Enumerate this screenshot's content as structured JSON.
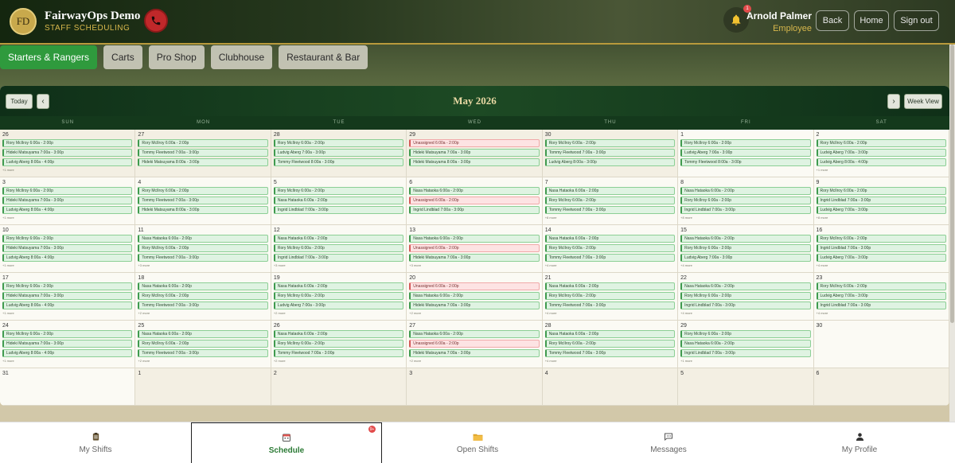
{
  "header": {
    "logo_text": "FD",
    "brand_title": "FairwayOps Demo",
    "brand_subtitle": "STAFF SCHEDULING",
    "notification_count": "1",
    "user_name": "Arnold Palmer",
    "user_role": "Employee",
    "back_label": "Back",
    "home_label": "Home",
    "signout_label": "Sign out"
  },
  "tabs": [
    {
      "label": "Starters & Rangers",
      "active": true
    },
    {
      "label": "Carts",
      "active": false
    },
    {
      "label": "Pro Shop",
      "active": false
    },
    {
      "label": "Clubhouse",
      "active": false
    },
    {
      "label": "Restaurant & Bar",
      "active": false
    }
  ],
  "calendar": {
    "title": "May 2026",
    "today_label": "Today",
    "prev_label": "‹",
    "next_label": "›",
    "view_label": "Week View",
    "weekdays": [
      "SUN",
      "MON",
      "TUE",
      "WED",
      "THU",
      "FRI",
      "SAT"
    ],
    "weeks": [
      [
        {
          "day": "26",
          "out": true,
          "shifts": [
            [
              "Rory McIlroy 6:00a - 2:00p",
              false
            ],
            [
              "Hideki Matsuyama 7:00a - 3:00p",
              false
            ],
            [
              "Ludvig Aberg 8:00a - 4:00p",
              false
            ]
          ],
          "more": "+1 more"
        },
        {
          "day": "27",
          "out": true,
          "shifts": [
            [
              "Rory McIlroy 6:00a - 2:00p",
              false
            ],
            [
              "Tommy Fleetwood 7:00a - 3:00p",
              false
            ],
            [
              "Hideki Matsuyama 8:00a - 3:00p",
              false
            ]
          ],
          "more": ""
        },
        {
          "day": "28",
          "out": true,
          "shifts": [
            [
              "Rory McIlroy 6:00a - 2:00p",
              false
            ],
            [
              "Ludvig Aberg 7:00a - 3:00p",
              false
            ],
            [
              "Tommy Fleetwood 8:00a - 3:00p",
              false
            ]
          ],
          "more": ""
        },
        {
          "day": "29",
          "out": true,
          "shifts": [
            [
              "Unassigned 6:00a - 2:00p",
              true
            ],
            [
              "Hideki Matsuyama 7:00a - 3:00p",
              false
            ],
            [
              "Hideki Matsuyama 8:00a - 3:00p",
              false
            ]
          ],
          "more": ""
        },
        {
          "day": "30",
          "out": true,
          "shifts": [
            [
              "Rory McIlroy 6:00a - 2:00p",
              false
            ],
            [
              "Tommy Fleetwood 7:00a - 3:00p",
              false
            ],
            [
              "Ludvig Aberg 8:00a - 3:00p",
              false
            ]
          ],
          "more": ""
        },
        {
          "day": "1",
          "out": false,
          "shifts": [
            [
              "Rory McIlroy 6:00a - 2:00p",
              false
            ],
            [
              "Ludvig Aberg 7:00a - 3:00p",
              false
            ],
            [
              "Tommy Fleetwood 8:00a - 3:00p",
              false
            ]
          ],
          "more": ""
        },
        {
          "day": "2",
          "out": false,
          "shifts": [
            [
              "Rory McIlroy 6:00a - 2:00p",
              false
            ],
            [
              "Ludvig Aberg 7:00a - 3:00p",
              false
            ],
            [
              "Ludvig Aberg 8:00a - 4:00p",
              false
            ]
          ],
          "more": "+1 more"
        }
      ],
      [
        {
          "day": "3",
          "out": false,
          "shifts": [
            [
              "Rory McIlroy 6:00a - 2:00p",
              false
            ],
            [
              "Hideki Matsuyama 7:00a - 3:00p",
              false
            ],
            [
              "Ludvig Aberg 8:00a - 4:00p",
              false
            ]
          ],
          "more": "+1 more"
        },
        {
          "day": "4",
          "out": false,
          "shifts": [
            [
              "Rory McIlroy 6:00a - 2:00p",
              false
            ],
            [
              "Tommy Fleetwood 7:00a - 3:00p",
              false
            ],
            [
              "Hideki Matsuyama 8:00a - 3:00p",
              false
            ]
          ],
          "more": ""
        },
        {
          "day": "5",
          "out": false,
          "shifts": [
            [
              "Rory McIlroy 6:00a - 2:00p",
              false
            ],
            [
              "Nasa Hataoka 6:00a - 2:00p",
              false
            ],
            [
              "Ingrid Lindblad 7:00a - 3:00p",
              false
            ]
          ],
          "more": ""
        },
        {
          "day": "6",
          "out": false,
          "shifts": [
            [
              "Nasa Hataoka 6:00a - 2:00p",
              false
            ],
            [
              "Unassigned 6:00a - 2:00p",
              true
            ],
            [
              "Ingrid Lindblad 7:00a - 3:00p",
              false
            ]
          ],
          "more": ""
        },
        {
          "day": "7",
          "out": false,
          "shifts": [
            [
              "Nasa Hataoka 6:00a - 2:00p",
              false
            ],
            [
              "Rory McIlroy 6:00a - 2:00p",
              false
            ],
            [
              "Tommy Fleetwood 7:00a - 3:00p",
              false
            ]
          ],
          "more": "+8 more"
        },
        {
          "day": "8",
          "out": false,
          "shifts": [
            [
              "Nasa Hataoka 6:00a - 2:00p",
              false
            ],
            [
              "Rory McIlroy 6:00a - 2:00p",
              false
            ],
            [
              "Ingrid Lindblad 7:00a - 3:00p",
              false
            ]
          ],
          "more": "+8 more"
        },
        {
          "day": "9",
          "out": false,
          "shifts": [
            [
              "Rory McIlroy 6:00a - 2:00p",
              false
            ],
            [
              "Ingrid Lindblad 7:00a - 3:00p",
              false
            ],
            [
              "Ludvig Aberg 7:00a - 3:00p",
              false
            ]
          ],
          "more": "+8 more"
        }
      ],
      [
        {
          "day": "10",
          "out": false,
          "shifts": [
            [
              "Rory McIlroy 6:00a - 2:00p",
              false
            ],
            [
              "Hideki Matsuyama 7:00a - 3:00p",
              false
            ],
            [
              "Ludvig Aberg 8:00a - 4:00p",
              false
            ]
          ],
          "more": "+1 more"
        },
        {
          "day": "11",
          "out": false,
          "shifts": [
            [
              "Nasa Hataoka 6:00a - 2:00p",
              false
            ],
            [
              "Rory McIlroy 6:00a - 2:00p",
              false
            ],
            [
              "Tommy Fleetwood 7:00a - 3:00p",
              false
            ]
          ],
          "more": "+3 more"
        },
        {
          "day": "12",
          "out": false,
          "shifts": [
            [
              "Nasa Hataoka 6:00a - 2:00p",
              false
            ],
            [
              "Rory McIlroy 6:00a - 2:00p",
              false
            ],
            [
              "Ingrid Lindblad 7:00a - 3:00p",
              false
            ]
          ],
          "more": "+3 more"
        },
        {
          "day": "13",
          "out": false,
          "shifts": [
            [
              "Nasa Hataoka 6:00a - 2:00p",
              false
            ],
            [
              "Unassigned 6:00a - 2:00p",
              true
            ],
            [
              "Hideki Matsuyama 7:00a - 3:00p",
              false
            ]
          ],
          "more": "+3 more"
        },
        {
          "day": "14",
          "out": false,
          "shifts": [
            [
              "Nasa Hataoka 6:00a - 2:00p",
              false
            ],
            [
              "Rory McIlroy 6:00a - 2:00p",
              false
            ],
            [
              "Tommy Fleetwood 7:00a - 3:00p",
              false
            ]
          ],
          "more": "+4 more"
        },
        {
          "day": "15",
          "out": false,
          "shifts": [
            [
              "Nasa Hataoka 6:00a - 2:00p",
              false
            ],
            [
              "Rory McIlroy 6:00a - 2:00p",
              false
            ],
            [
              "Ludvig Aberg 7:00a - 3:00p",
              false
            ]
          ],
          "more": "+4 more"
        },
        {
          "day": "16",
          "out": false,
          "shifts": [
            [
              "Rory McIlroy 6:00a - 2:00p",
              false
            ],
            [
              "Ingrid Lindblad 7:00a - 3:00p",
              false
            ],
            [
              "Ludvig Aberg 7:00a - 3:00p",
              false
            ]
          ],
          "more": "+4 more"
        }
      ],
      [
        {
          "day": "17",
          "out": false,
          "shifts": [
            [
              "Rory McIlroy 6:00a - 2:00p",
              false
            ],
            [
              "Hideki Matsuyama 7:00a - 3:00p",
              false
            ],
            [
              "Ludvig Aberg 8:00a - 4:00p",
              false
            ]
          ],
          "more": "+1 more"
        },
        {
          "day": "18",
          "out": false,
          "shifts": [
            [
              "Nasa Hataoka 6:00a - 2:00p",
              false
            ],
            [
              "Rory McIlroy 6:00a - 2:00p",
              false
            ],
            [
              "Tommy Fleetwood 7:00a - 3:00p",
              false
            ]
          ],
          "more": "+2 more"
        },
        {
          "day": "19",
          "out": false,
          "shifts": [
            [
              "Nasa Hataoka 6:00a - 2:00p",
              false
            ],
            [
              "Rory McIlroy 6:00a - 2:00p",
              false
            ],
            [
              "Ludvig Aberg 7:00a - 3:00p",
              false
            ]
          ],
          "more": "+2 more"
        },
        {
          "day": "20",
          "out": false,
          "shifts": [
            [
              "Unassigned 6:00a - 2:00p",
              true
            ],
            [
              "Nasa Hataoka 6:00a - 2:00p",
              false
            ],
            [
              "Hideki Matsuyama 7:00a - 3:00p",
              false
            ]
          ],
          "more": "+2 more"
        },
        {
          "day": "21",
          "out": false,
          "shifts": [
            [
              "Nasa Hataoka 6:00a - 2:00p",
              false
            ],
            [
              "Rory McIlroy 6:00a - 2:00p",
              false
            ],
            [
              "Tommy Fleetwood 7:00a - 3:00p",
              false
            ]
          ],
          "more": "+4 more"
        },
        {
          "day": "22",
          "out": false,
          "shifts": [
            [
              "Nasa Hataoka 6:00a - 2:00p",
              false
            ],
            [
              "Rory McIlroy 6:00a - 2:00p",
              false
            ],
            [
              "Ingrid Lindblad 7:00a - 3:00p",
              false
            ]
          ],
          "more": "+4 more"
        },
        {
          "day": "23",
          "out": false,
          "shifts": [
            [
              "Rory McIlroy 6:00a - 2:00p",
              false
            ],
            [
              "Ludvig Aberg 7:00a - 3:00p",
              false
            ],
            [
              "Ingrid Lindblad 7:00a - 3:00p",
              false
            ]
          ],
          "more": "+4 more"
        }
      ],
      [
        {
          "day": "24",
          "out": false,
          "shifts": [
            [
              "Rory McIlroy 6:00a - 2:00p",
              false
            ],
            [
              "Hideki Matsuyama 7:00a - 3:00p",
              false
            ],
            [
              "Ludvig Aberg 8:00a - 4:00p",
              false
            ]
          ],
          "more": "+1 more"
        },
        {
          "day": "25",
          "out": false,
          "shifts": [
            [
              "Nasa Hataoka 6:00a - 2:00p",
              false
            ],
            [
              "Rory McIlroy 6:00a - 2:00p",
              false
            ],
            [
              "Tommy Fleetwood 7:00a - 3:00p",
              false
            ]
          ],
          "more": "+2 more"
        },
        {
          "day": "26",
          "out": false,
          "shifts": [
            [
              "Nasa Hataoka 6:00a - 2:00p",
              false
            ],
            [
              "Rory McIlroy 6:00a - 2:00p",
              false
            ],
            [
              "Tommy Fleetwood 7:00a - 3:00p",
              false
            ]
          ],
          "more": "+2 more"
        },
        {
          "day": "27",
          "out": false,
          "shifts": [
            [
              "Nasa Hataoka 6:00a - 2:00p",
              false
            ],
            [
              "Unassigned 6:00a - 2:00p",
              true
            ],
            [
              "Hideki Matsuyama 7:00a - 3:00p",
              false
            ]
          ],
          "more": "+2 more"
        },
        {
          "day": "28",
          "out": false,
          "shifts": [
            [
              "Nasa Hataoka 6:00a - 2:00p",
              false
            ],
            [
              "Rory McIlroy 6:00a - 2:00p",
              false
            ],
            [
              "Tommy Fleetwood 7:00a - 3:00p",
              false
            ]
          ],
          "more": "+4 more"
        },
        {
          "day": "29",
          "out": false,
          "shifts": [
            [
              "Rory McIlroy 6:00a - 2:00p",
              false
            ],
            [
              "Nasa Hataoka 6:00a - 2:00p",
              false
            ],
            [
              "Ingrid Lindblad 7:00a - 3:00p",
              false
            ]
          ],
          "more": "+1 more"
        },
        {
          "day": "30",
          "out": false,
          "shifts": [],
          "more": ""
        }
      ],
      [
        {
          "day": "31",
          "out": false,
          "shifts": [],
          "more": ""
        },
        {
          "day": "1",
          "out": true,
          "shifts": [],
          "more": ""
        },
        {
          "day": "2",
          "out": true,
          "shifts": [],
          "more": ""
        },
        {
          "day": "3",
          "out": true,
          "shifts": [],
          "more": ""
        },
        {
          "day": "4",
          "out": true,
          "shifts": [],
          "more": ""
        },
        {
          "day": "5",
          "out": true,
          "shifts": [],
          "more": ""
        },
        {
          "day": "6",
          "out": true,
          "shifts": [],
          "more": ""
        }
      ]
    ]
  },
  "bottom_nav": [
    {
      "label": "My Shifts",
      "icon": "clipboard-icon",
      "active": false
    },
    {
      "label": "Schedule",
      "icon": "calendar-icon",
      "active": true
    },
    {
      "label": "Open Shifts",
      "icon": "folder-icon",
      "active": false
    },
    {
      "label": "Messages",
      "icon": "chat-icon",
      "active": false
    },
    {
      "label": "My Profile",
      "icon": "user-icon",
      "active": false
    }
  ],
  "open_shifts_badge": "9+",
  "colors": {
    "accent": "#2f9a3d",
    "gold": "#d8b84c",
    "header_dark": "#14260f",
    "alert": "#c0282a"
  }
}
